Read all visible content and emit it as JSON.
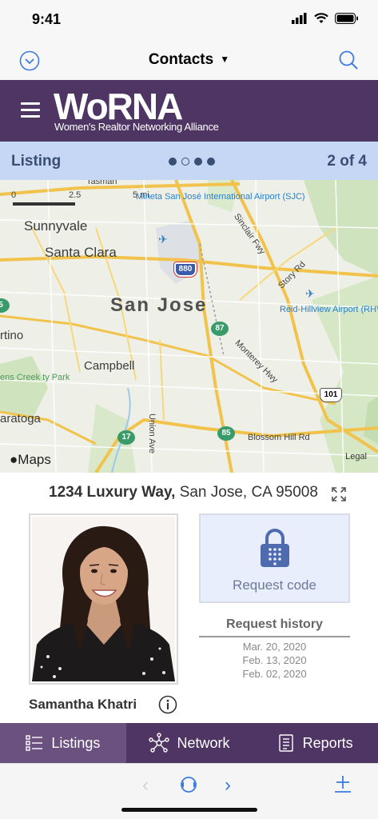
{
  "status_bar": {
    "time": "9:41"
  },
  "nav": {
    "title": "Contacts"
  },
  "brand": {
    "logo": "WoRNA",
    "subtitle": "Women's Realtor Networking Alliance"
  },
  "listing": {
    "label": "Listing",
    "count": "2 of 4",
    "dots_total": 4,
    "dots_active": 1
  },
  "map": {
    "scale_labels": [
      "0",
      "2.5",
      "5 mi"
    ],
    "cities": [
      "Sunnyvale",
      "Santa Clara",
      "San Jose",
      "Campbell",
      "rtino",
      "aratoga"
    ],
    "airports": [
      "Mineta San José International Airport (SJC)",
      "Reid-Hillview Airport (RHV)"
    ],
    "roads": [
      "Sinclair Fwy",
      "Story Rd",
      "Monterey Hwy",
      "Union Ave",
      "Blossom Hill Rd",
      "Tasman"
    ],
    "parks": [
      "ens Creek ty Park"
    ],
    "highway_shields": [
      "880",
      "87",
      "101",
      "17",
      "85",
      "5"
    ],
    "maps_logo": "Maps",
    "legal": "Legal"
  },
  "property": {
    "street": "1234 Luxury Way,",
    "city": "San Jose, CA 95008"
  },
  "agent": {
    "name": "Samantha Khatri"
  },
  "request": {
    "button_label": "Request code",
    "history_title": "Request history",
    "history": [
      "Mar. 20, 2020",
      "Feb. 13, 2020",
      "Feb. 02, 2020"
    ]
  },
  "tabs": [
    {
      "label": "Listings",
      "icon": "list-icon",
      "active": true
    },
    {
      "label": "Network",
      "icon": "network-icon",
      "active": false
    },
    {
      "label": "Reports",
      "icon": "report-icon",
      "active": false
    }
  ],
  "colors": {
    "brand_purple": "#4e3563",
    "listing_blue": "#c5d7f4",
    "accent_blue": "#3b7be0"
  }
}
